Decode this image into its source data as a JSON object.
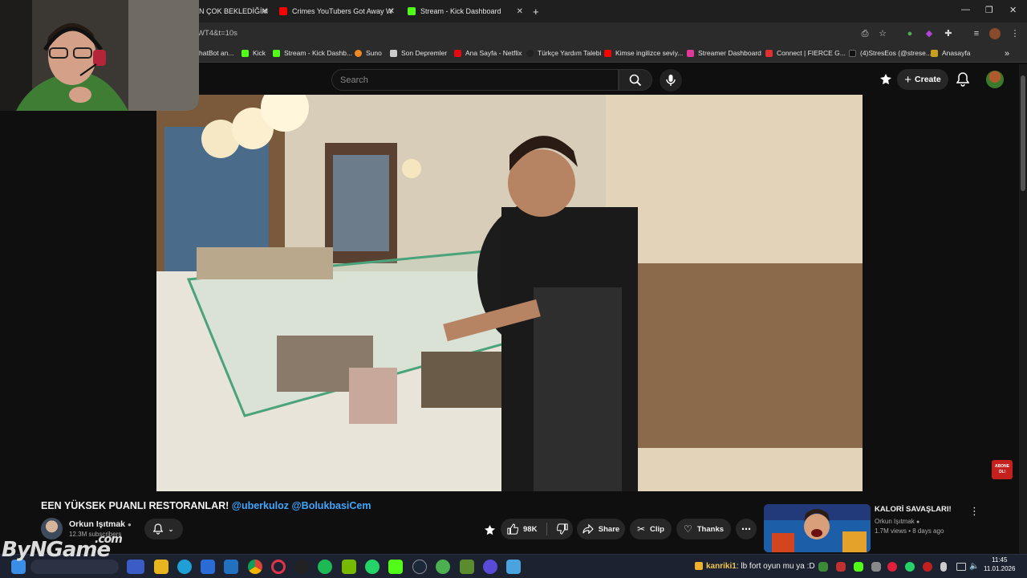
{
  "browser": {
    "tabs": [
      {
        "label": "N ÇOK BEKLEDİĞİM",
        "color": "#ff0000"
      },
      {
        "label": "Crimes YouTubers Got Away W",
        "color": "#ff0000"
      },
      {
        "label": "Stream - Kick Dashboard",
        "color": "#53fc18"
      }
    ],
    "url": "WT4&t=10s",
    "bookmarks": [
      {
        "label": "hatBot an...",
        "color": "#666666"
      },
      {
        "label": "Kick",
        "color": "#53fc18"
      },
      {
        "label": "Stream - Kick Dashb...",
        "color": "#53fc18"
      },
      {
        "label": "Suno",
        "color": "#f08a24"
      },
      {
        "label": "Son Depremler",
        "color": "#cccccc"
      },
      {
        "label": "Ana Sayfa - Netflix",
        "color": "#e50914"
      },
      {
        "label": "Türkçe Yardım Talebi",
        "color": "#222222"
      },
      {
        "label": "Kimse ingilizce seviy...",
        "color": "#ff0000"
      },
      {
        "label": "Streamer Dashboard",
        "color": "#e0399a"
      },
      {
        "label": "Connect | FIERCE G...",
        "color": "#e03030"
      },
      {
        "label": "(4)StresEos (@strese...",
        "color": "#111111"
      },
      {
        "label": "Anasayfa",
        "color": "#c8a020"
      }
    ]
  },
  "youtube": {
    "search_placeholder": "Search",
    "create_label": "Create",
    "video": {
      "title_main": "EEN YÜKSEK PUANLI RESTORANLAR! ",
      "mention1": "@uberkuloz",
      "mention2": "@BolukbasiCem",
      "channel": "Orkun Işıtmak",
      "subscribers": "12.3M subscribers",
      "likes": "98K",
      "share": "Share",
      "clip": "Clip",
      "thanks": "Thanks",
      "overlay_badge": "ABONE OL!"
    },
    "recommended": {
      "title": "KALORİ SAVAŞLARI!",
      "channel": "Orkun Işıtmak",
      "meta": "1.7M views • 8 days ago"
    }
  },
  "taskbar": {
    "time": "11:45",
    "date": "11.01.2026",
    "chat_user": "kanriki1",
    "chat_text": ": lb fort oyun mu ya :D"
  },
  "watermark": {
    "text": "ByNGame",
    "suffix": ".com"
  }
}
